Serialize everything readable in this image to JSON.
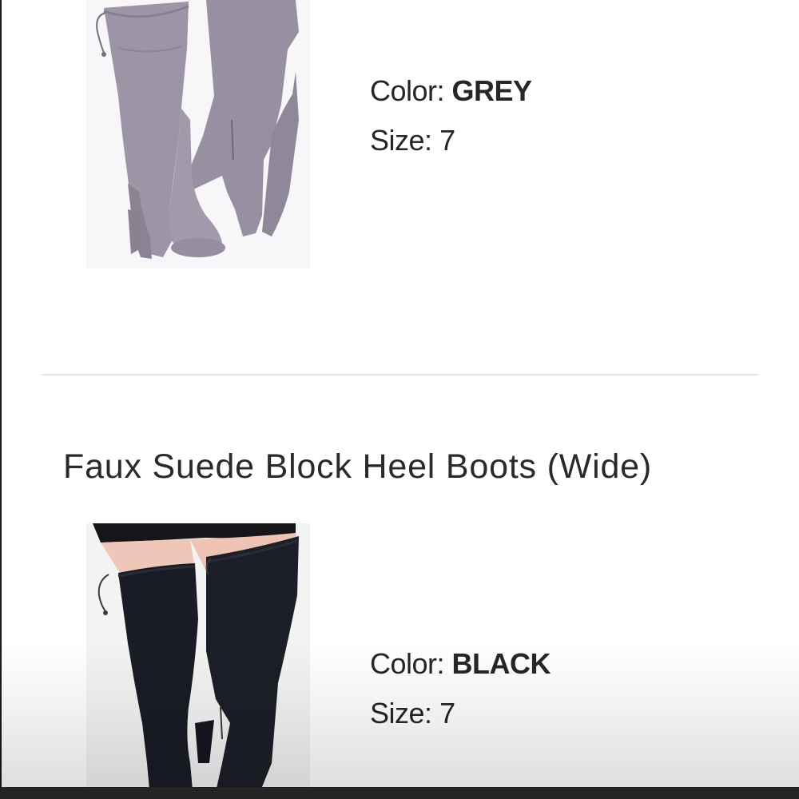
{
  "products": [
    {
      "image_alt": "Grey faux suede over-the-knee block heel boot",
      "color_label": "Color:",
      "color_value": "GREY",
      "size_label": "Size:",
      "size_value": "7",
      "boot_color": "#9c94a4"
    },
    {
      "title": "Faux Suede Block Heel Boots (Wide)",
      "image_alt": "Black faux suede over-the-knee block heel boot",
      "color_label": "Color:",
      "color_value": "BLACK",
      "size_label": "Size:",
      "size_value": "7",
      "boot_color": "#1b1d26"
    }
  ]
}
